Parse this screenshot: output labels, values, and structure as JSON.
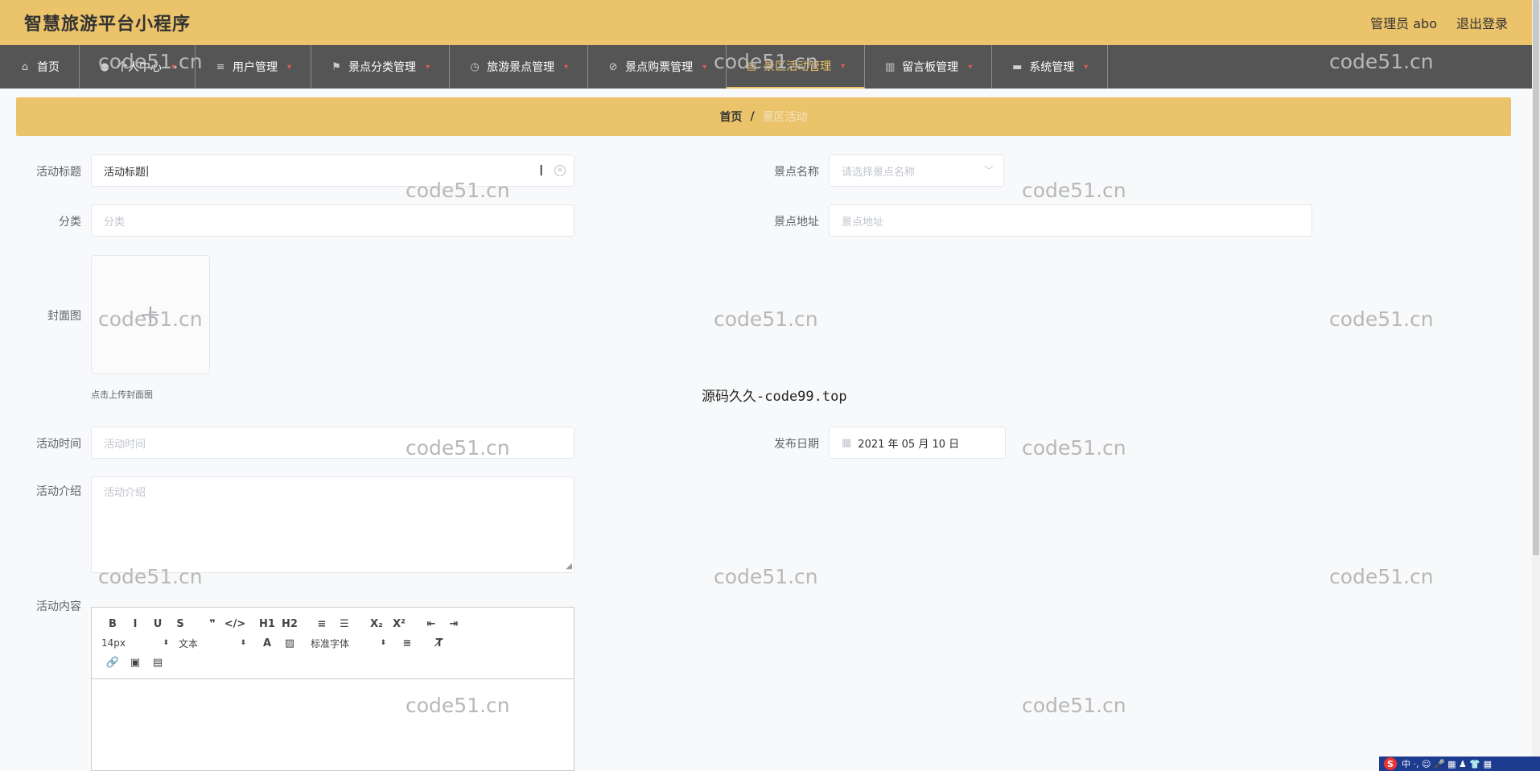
{
  "header": {
    "app_title": "智慧旅游平台小程序",
    "user_label": "管理员 abo",
    "logout_label": "退出登录"
  },
  "nav": {
    "items": [
      {
        "label": "首页",
        "icon": "home-icon"
      },
      {
        "label": "个人中心",
        "icon": "user-icon"
      },
      {
        "label": "用户管理",
        "icon": "list-icon"
      },
      {
        "label": "景点分类管理",
        "icon": "flag-icon"
      },
      {
        "label": "旅游景点管理",
        "icon": "clock-icon"
      },
      {
        "label": "景点购票管理",
        "icon": "compass-icon"
      },
      {
        "label": "景区活动管理",
        "icon": "document-icon"
      },
      {
        "label": "留言板管理",
        "icon": "briefcase-icon"
      },
      {
        "label": "系统管理",
        "icon": "monitor-icon"
      }
    ],
    "active_index": 6,
    "accent_color": "#ebc36b"
  },
  "breadcrumb": {
    "home": "首页",
    "separator": "/",
    "current": "景区活动"
  },
  "form": {
    "title_label": "活动标题",
    "title_value": "活动标题",
    "scenic_name_label": "景点名称",
    "scenic_name_placeholder": "请选择景点名称",
    "category_label": "分类",
    "category_placeholder": "分类",
    "scenic_address_label": "景点地址",
    "scenic_address_placeholder": "景点地址",
    "cover_label": "封面图",
    "cover_tip": "点击上传封面图",
    "time_label": "活动时间",
    "time_placeholder": "活动时间",
    "publish_date_label": "发布日期",
    "publish_date_value": "2021 年 05 月 10 日",
    "intro_label": "活动介绍",
    "intro_placeholder": "活动介绍",
    "content_label": "活动内容"
  },
  "editor": {
    "font_size": "14px",
    "header_select": "文本",
    "font_family": "标准字体",
    "buttons_row1": [
      "B",
      "I",
      "U",
      "S",
      "❞",
      "</>",
      "H1",
      "H2",
      "≡",
      "☰",
      "X₂",
      "X²",
      "⇤",
      "⇥"
    ],
    "buttons_row3": [
      "link-icon",
      "image-icon",
      "video-icon"
    ]
  },
  "overlay": {
    "center_text": "源码久久-code99.top",
    "watermark": "code51.cn"
  },
  "ime": {
    "logo": "S",
    "label": "中 ·, ☺ 🎤 ▦ ♟ 👕 ▦"
  }
}
